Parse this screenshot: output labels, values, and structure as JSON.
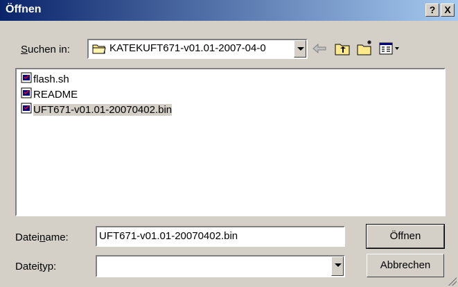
{
  "window": {
    "title": "Öffnen",
    "help_label": "?",
    "close_label": "X"
  },
  "look_in": {
    "label": "Suchen in:",
    "value": "KATEKUFT671-v01.01-2007-04-0"
  },
  "toolbar": {
    "icons": [
      "back-arrow-icon",
      "up-folder-icon",
      "new-folder-icon",
      "view-menu-icon"
    ]
  },
  "files": [
    {
      "name": "flash.sh",
      "icon": "file-icon"
    },
    {
      "name": "README",
      "icon": "file-icon"
    },
    {
      "name": "UFT671-v01.01-20070402.bin",
      "icon": "file-icon",
      "selected": true
    }
  ],
  "filename": {
    "label": "Dateiname:",
    "value": "UFT671-v01.01-20070402.bin"
  },
  "filetype": {
    "label": "Dateityp:",
    "value": ""
  },
  "buttons": {
    "open": "Öffnen",
    "cancel": "Abbrechen"
  },
  "colors": {
    "title_start": "#0a246a",
    "title_end": "#a6caf0",
    "face": "#d4d0c8"
  }
}
